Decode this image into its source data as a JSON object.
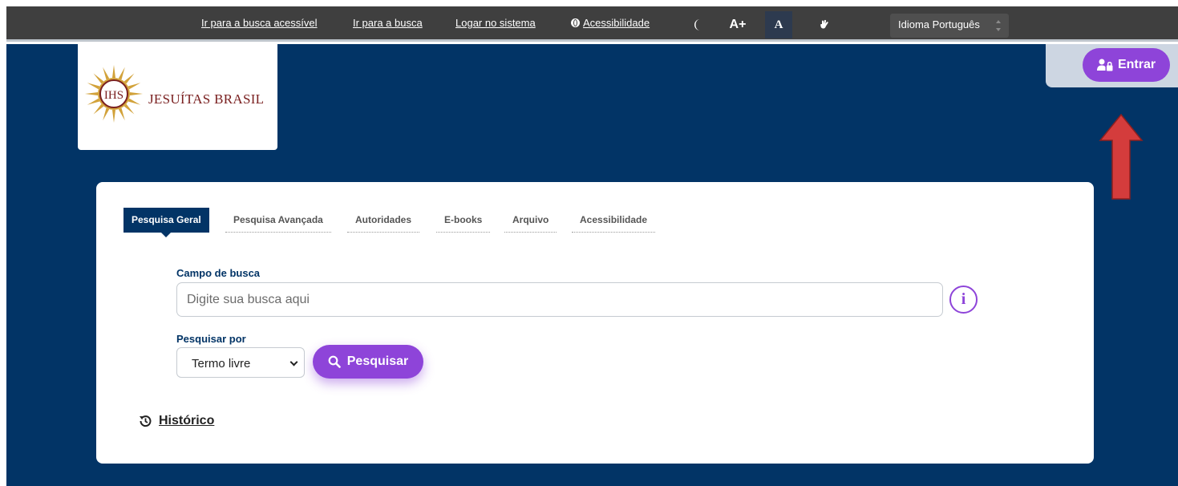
{
  "topbar": {
    "links": [
      "Ir para a busca acessível",
      "Ir para a busca",
      "Logar no sistema",
      "Acessibilidade"
    ],
    "contrast_icon": "moon-icon",
    "font_increase": "A+",
    "font_normal": "A",
    "sign_language_icon": "hand-icon",
    "language_select": "Idioma Português"
  },
  "header": {
    "logo_text": "JESUÍTAS BRASIL",
    "emblem_text": "IHS",
    "login_button": "Entrar"
  },
  "search": {
    "tabs": [
      "Pesquisa Geral",
      "Pesquisa Avançada",
      "Autoridades",
      "E-books",
      "Arquivo",
      "Acessibilidade"
    ],
    "active_tab": "Pesquisa Geral",
    "field_label": "Campo de busca",
    "placeholder": "Digite sua busca aqui",
    "info_icon": "i",
    "search_by_label": "Pesquisar por",
    "search_by_value": "Termo livre",
    "submit_button": "Pesquisar",
    "history_link": "Histórico"
  },
  "colors": {
    "navy": "#023466",
    "purple": "#8e44d9",
    "topbar": "#3f3f3f",
    "logo_red": "#7a2020",
    "arrow_red": "#d43c3c"
  }
}
